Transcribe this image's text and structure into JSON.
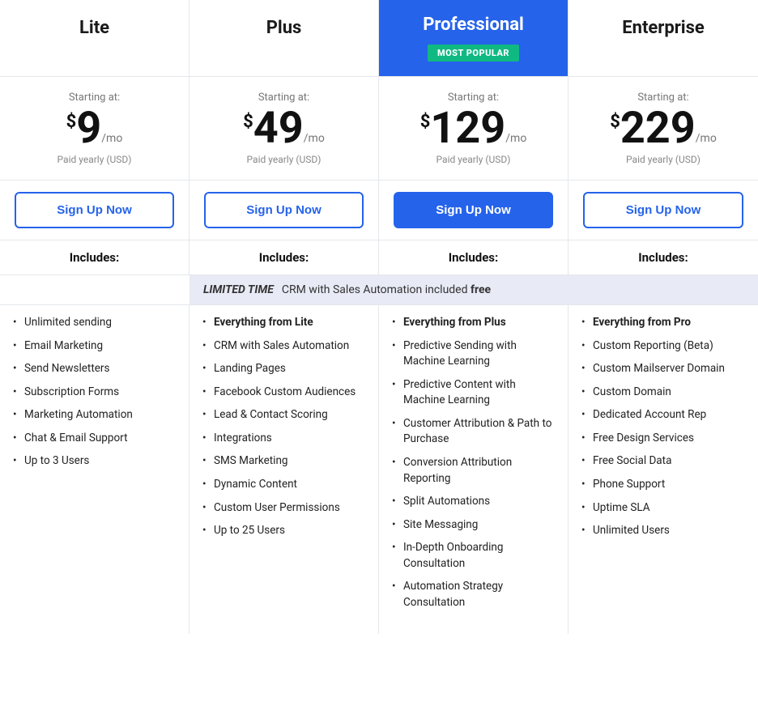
{
  "plans": [
    {
      "id": "lite",
      "name": "Lite",
      "isPro": false,
      "startingAt": "Starting at:",
      "dollar": "$",
      "price": "9",
      "perMo": "/mo",
      "paidYearly": "Paid yearly (USD)",
      "signupLabel": "Sign Up Now",
      "includesLabel": "Includes:",
      "features": [
        "Unlimited sending",
        "Email Marketing",
        "Send Newsletters",
        "Subscription Forms",
        "Marketing Automation",
        "Chat & Email Support",
        "Up to 3 Users"
      ],
      "featuresStrong": []
    },
    {
      "id": "plus",
      "name": "Plus",
      "isPro": false,
      "startingAt": "Starting at:",
      "dollar": "$",
      "price": "49",
      "perMo": "/mo",
      "paidYearly": "Paid yearly (USD)",
      "signupLabel": "Sign Up Now",
      "includesLabel": "Includes:",
      "features": [
        "Everything from Lite",
        "CRM with Sales Automation",
        "Landing Pages",
        "Facebook Custom Audiences",
        "Lead & Contact Scoring",
        "Integrations",
        "SMS Marketing",
        "Dynamic Content",
        "Custom User Permissions",
        "Up to 25 Users"
      ],
      "featuresStrong": [
        "Everything from Lite"
      ]
    },
    {
      "id": "professional",
      "name": "Professional",
      "isPro": true,
      "badge": "MOST POPULAR",
      "startingAt": "Starting at:",
      "dollar": "$",
      "price": "129",
      "perMo": "/mo",
      "paidYearly": "Paid yearly (USD)",
      "signupLabel": "Sign Up Now",
      "includesLabel": "Includes:",
      "features": [
        "Everything from Plus",
        "Predictive Sending with Machine Learning",
        "Predictive Content with Machine Learning",
        "Customer Attribution & Path to Purchase",
        "Conversion Attribution Reporting",
        "Split Automations",
        "Site Messaging",
        "In-Depth Onboarding Consultation",
        "Automation Strategy Consultation"
      ],
      "featuresStrong": [
        "Everything from Plus"
      ]
    },
    {
      "id": "enterprise",
      "name": "Enterprise",
      "isPro": false,
      "startingAt": "Starting at:",
      "dollar": "$",
      "price": "229",
      "perMo": "/mo",
      "paidYearly": "Paid yearly (USD)",
      "signupLabel": "Sign Up Now",
      "includesLabel": "Includes:",
      "features": [
        "Everything from Pro",
        "Custom Reporting (Beta)",
        "Custom Mailserver Domain",
        "Custom Domain",
        "Dedicated Account Rep",
        "Free Design Services",
        "Free Social Data",
        "Phone Support",
        "Uptime SLA",
        "Unlimited Users"
      ],
      "featuresStrong": [
        "Everything from Pro"
      ]
    }
  ],
  "banner": {
    "label": "LIMITED TIME",
    "text": "CRM with Sales Automation included ",
    "textBold": "free"
  }
}
